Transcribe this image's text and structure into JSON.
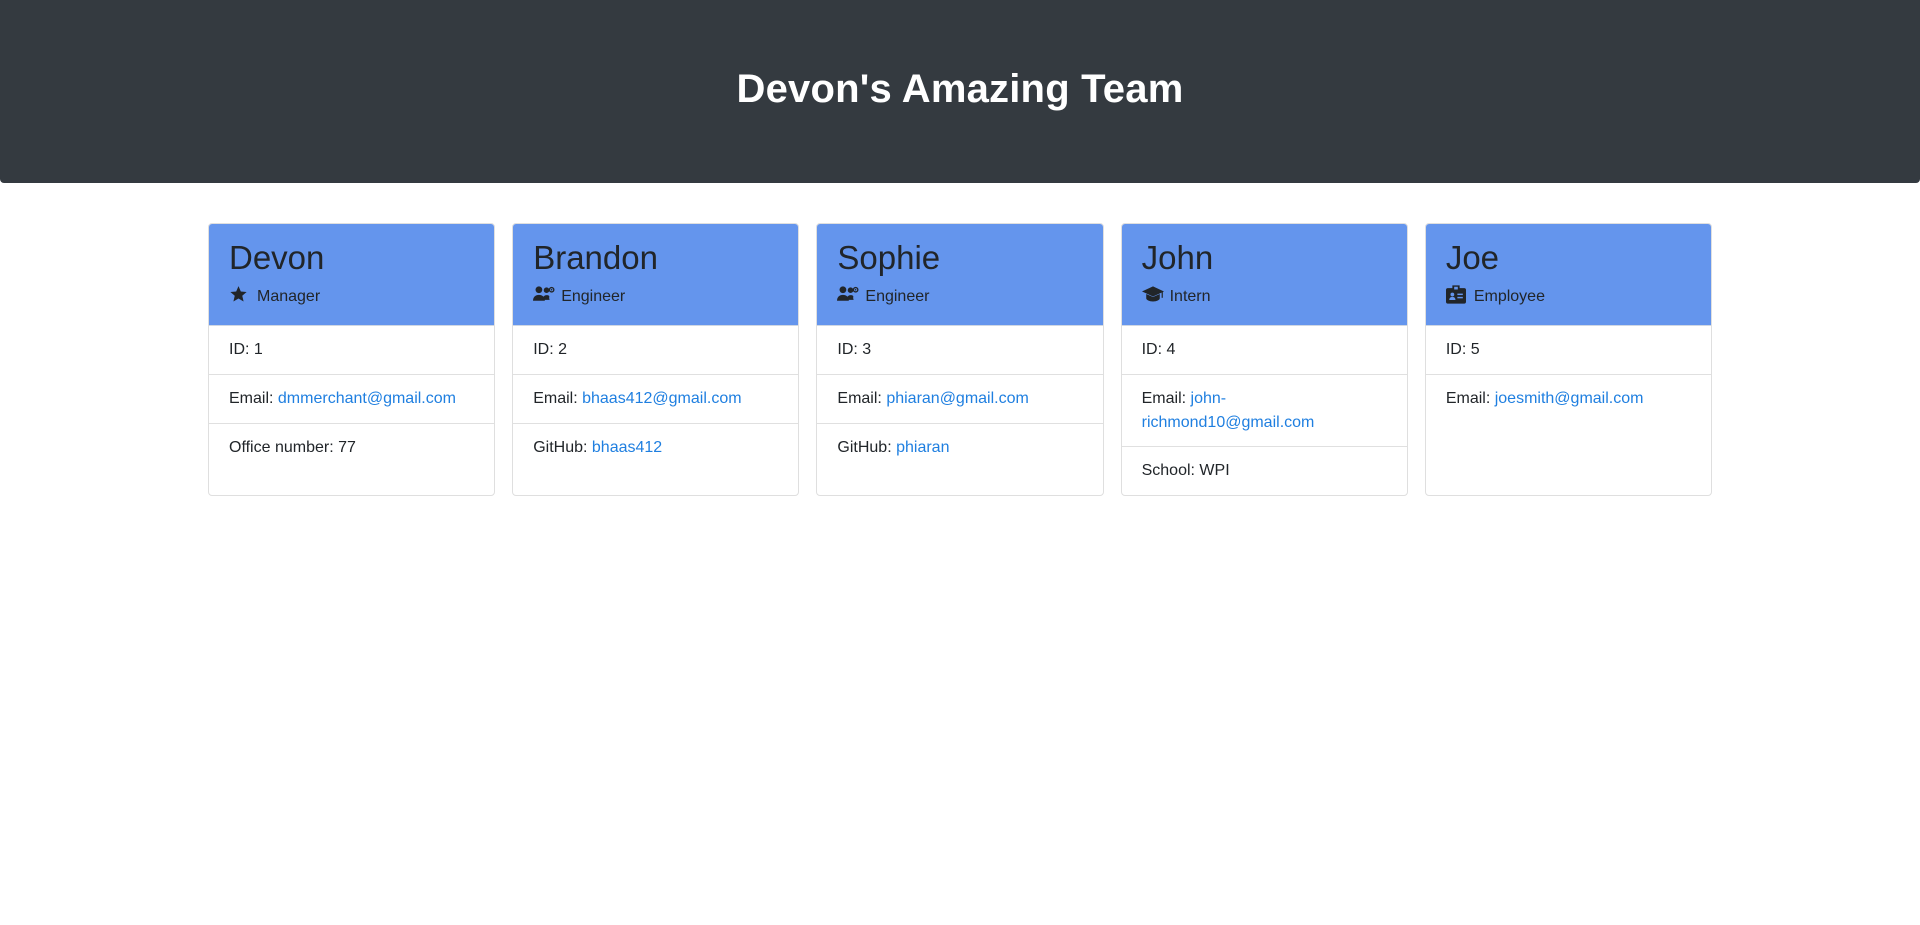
{
  "header": {
    "title": "Devon's Amazing Team"
  },
  "team": [
    {
      "name": "Devon",
      "role": "Manager",
      "icon": "star-icon",
      "id_label": "ID: 1",
      "email_label": "Email: ",
      "email": "dmmerchant@gmail.com",
      "extra_label": "Office number: 77",
      "extra_link": ""
    },
    {
      "name": "Brandon",
      "role": "Engineer",
      "icon": "users-gear-icon",
      "id_label": "ID: 2",
      "email_label": "Email: ",
      "email": "bhaas412@gmail.com",
      "extra_label": "GitHub: ",
      "extra_link": "bhaas412"
    },
    {
      "name": "Sophie",
      "role": "Engineer",
      "icon": "users-gear-icon",
      "id_label": "ID: 3",
      "email_label": "Email: ",
      "email": "phiaran@gmail.com",
      "extra_label": "GitHub: ",
      "extra_link": "phiaran"
    },
    {
      "name": "John",
      "role": "Intern",
      "icon": "graduation-cap-icon",
      "id_label": "ID: 4",
      "email_label": "Email: ",
      "email": "john-richmond10@gmail.com",
      "extra_label": "School: WPI",
      "extra_link": ""
    },
    {
      "name": "Joe",
      "role": "Employee",
      "icon": "id-badge-icon",
      "id_label": "ID: 5",
      "email_label": "Email: ",
      "email": "joesmith@gmail.com",
      "extra_label": "",
      "extra_link": ""
    }
  ],
  "colors": {
    "header_bg": "#343a40",
    "card_header_bg": "#6495ed",
    "link": "#1f7fe0"
  }
}
